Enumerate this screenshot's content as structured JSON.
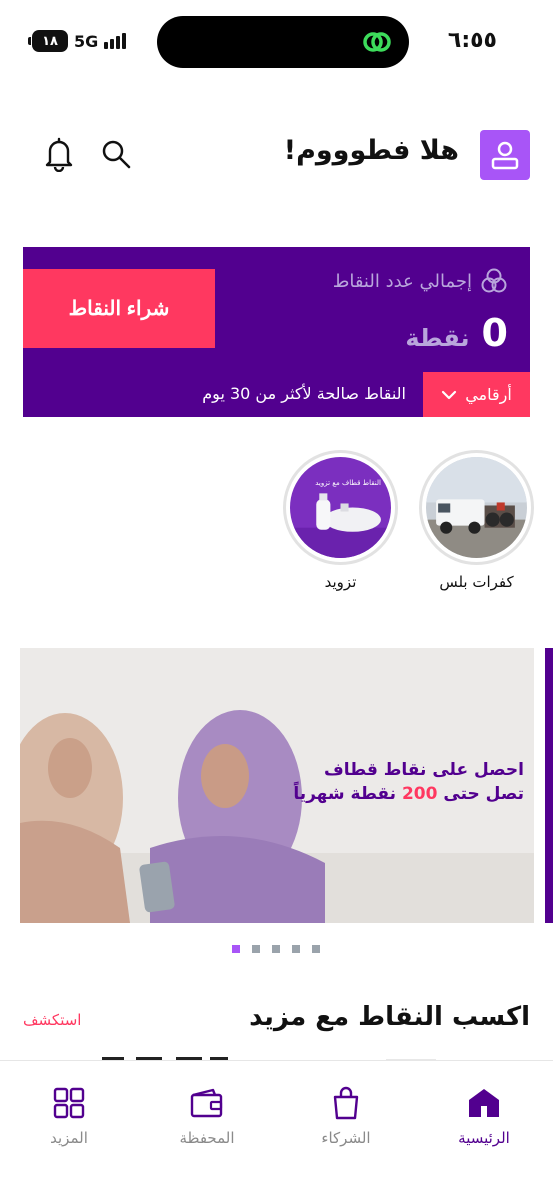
{
  "status_bar": {
    "time": "٦:٥٥",
    "battery": "١٨",
    "network": "5G"
  },
  "header": {
    "greeting": "هلا فطوووم!",
    "icons": [
      "user-icon",
      "search-icon",
      "bell-icon"
    ]
  },
  "points_card": {
    "label": "إجمالي عدد النقاط",
    "value": "0",
    "unit": "نقطة",
    "buy_button": "شراء النقاط",
    "dropdown_label": "أرقامي",
    "validity": "النقاط صالحة لأكثر من 30 يوم",
    "colors": {
      "background": "#52008f",
      "accent": "#ff3860"
    }
  },
  "partners": [
    {
      "name": "كفرات بلس"
    },
    {
      "name": "تزويد",
      "image_caption": "النقاط قطاف مع تزويد"
    }
  ],
  "banner": {
    "line1": "احصل على نقاط قطاف",
    "line2_prefix": "تصل حتى",
    "line2_highlight": "200",
    "line2_suffix": "نقطة شهرياً"
  },
  "carousel": {
    "total": 5,
    "active_index": 0
  },
  "section": {
    "title": "اكسب النقاط مع مزيد",
    "link": "استكشف"
  },
  "bottom_nav": {
    "home": "الرئيسية",
    "partners": "الشركاء",
    "wallet": "المحفظة",
    "more": "المزيد",
    "active": "home",
    "colors": {
      "active": "#52008f",
      "inactive": "#8a8a8a"
    }
  }
}
